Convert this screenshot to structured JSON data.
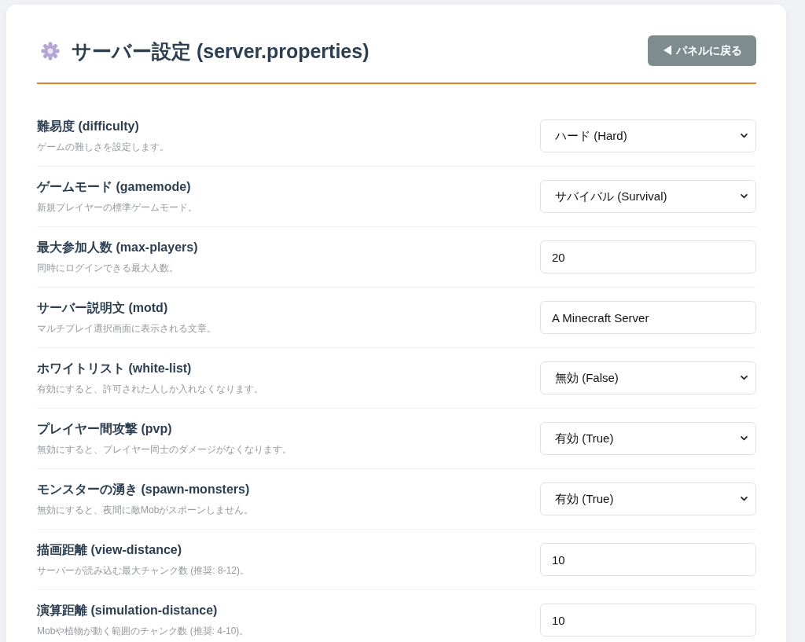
{
  "page": {
    "title": "サーバー設定 (server.properties)",
    "back_button": "◀ パネルに戻る"
  },
  "settings": [
    {
      "kind": "select",
      "label": "難易度 (difficulty)",
      "description": "ゲームの難しさを設定します。",
      "value": "ハード (Hard)"
    },
    {
      "kind": "select",
      "label": "ゲームモード (gamemode)",
      "description": "新規プレイヤーの標準ゲームモード。",
      "value": "サバイバル (Survival)"
    },
    {
      "kind": "input",
      "label": "最大参加人数 (max-players)",
      "description": "同時にログインできる最大人数。",
      "value": "20"
    },
    {
      "kind": "input",
      "label": "サーバー説明文 (motd)",
      "description": "マルチプレイ選択画面に表示される文章。",
      "value": "A Minecraft Server"
    },
    {
      "kind": "select",
      "label": "ホワイトリスト (white-list)",
      "description": "有効にすると、許可された人しか入れなくなります。",
      "value": "無効 (False)"
    },
    {
      "kind": "select",
      "label": "プレイヤー間攻撃 (pvp)",
      "description": "無効にすると、プレイヤー同士のダメージがなくなります。",
      "value": "有効 (True)"
    },
    {
      "kind": "select",
      "label": "モンスターの湧き (spawn-monsters)",
      "description": "無効にすると、夜間に敵Mobがスポーンしません。",
      "value": "有効 (True)"
    },
    {
      "kind": "input",
      "label": "描画距離 (view-distance)",
      "description": "サーバーが読み込む最大チャンク数 (推奨: 8-12)。",
      "value": "10"
    },
    {
      "kind": "input",
      "label": "演算距離 (simulation-distance)",
      "description": "Mobや植物が動く範囲のチャンク数 (推奨: 4-10)。",
      "value": "10"
    }
  ]
}
